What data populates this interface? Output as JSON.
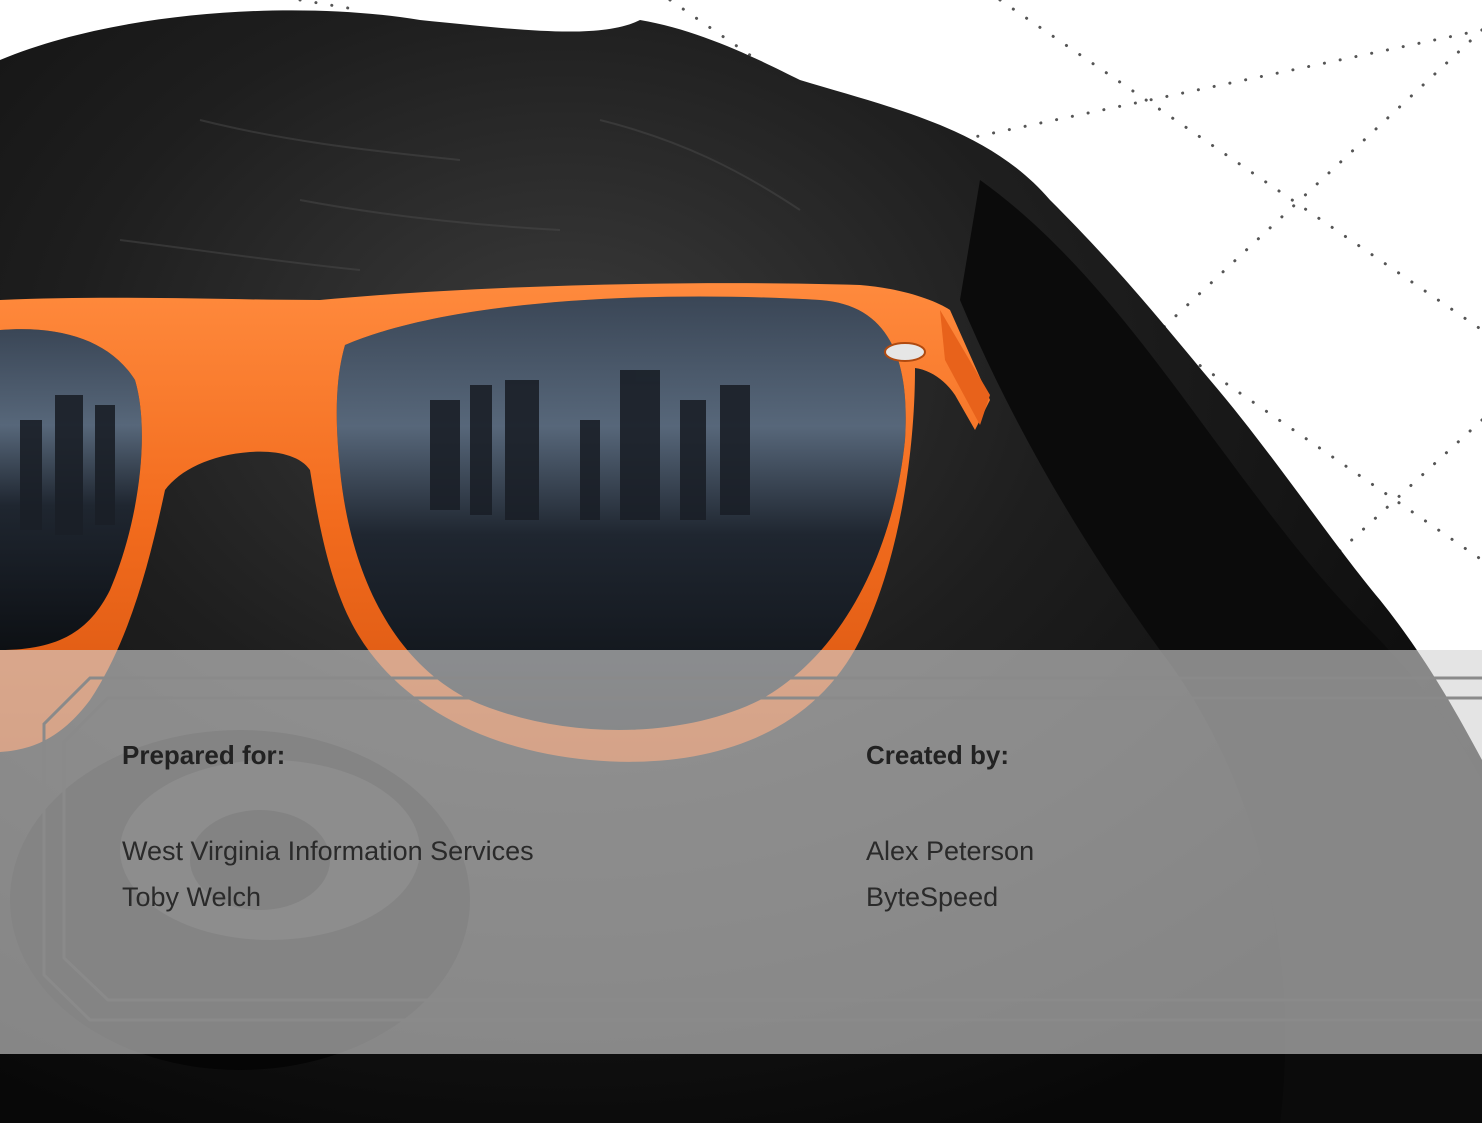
{
  "document": {
    "prepared_for": {
      "heading": "Prepared for:",
      "lines": [
        "West Virginia Information Services",
        "Toby Welch"
      ]
    },
    "created_by": {
      "heading": "Created by:",
      "lines": [
        "Alex Peterson",
        "ByteSpeed"
      ]
    }
  },
  "colors": {
    "sunglasses_frame": "#f26b1d",
    "dog_fur": "#141414",
    "panel_overlay": "#d4d4d4",
    "panel_border": "#8a8a8a",
    "dotted_lines": "#444444"
  }
}
